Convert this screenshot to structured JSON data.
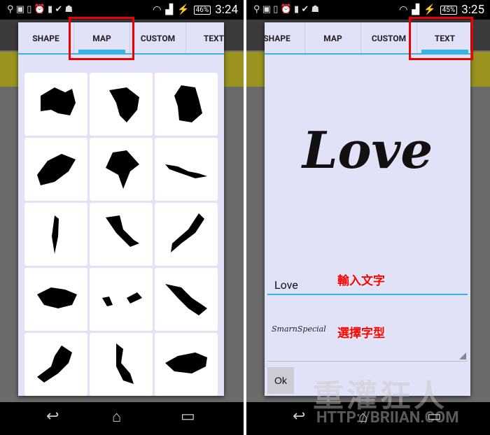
{
  "left": {
    "status": {
      "battery": "46%",
      "time": "3:24"
    },
    "tabs": [
      "SHAPE",
      "MAP",
      "CUSTOM",
      "TEXT"
    ],
    "selected_tab": "MAP",
    "map_tiles": [
      "australia-map-icon",
      "brazil-map-icon",
      "germany-map-icon",
      "switzerland-map-icon",
      "india-map-icon",
      "indonesia-map-icon",
      "israel-map-icon",
      "italy-map-icon",
      "japan-map-icon",
      "kazakhstan-map-icon",
      "malaysia-map-icon",
      "mexico-map-icon",
      "pakistan-map-icon",
      "philippines-map-icon",
      "russia-map-icon"
    ]
  },
  "right": {
    "status": {
      "battery": "45%",
      "time": "3:25"
    },
    "tabs": [
      "SHAPE",
      "MAP",
      "CUSTOM",
      "TEXT"
    ],
    "selected_tab": "TEXT",
    "preview_text": "Love",
    "input_value": "Love",
    "font_name": "SmarnSpecial",
    "ok_label": "Ok",
    "annotations": {
      "input": "輸入文字",
      "font": "選擇字型"
    }
  },
  "watermark": {
    "text": "重灌狂人",
    "url": "HTTP://BRIIAN.COM"
  },
  "colors": {
    "accent": "#33b5e5",
    "highlight": "#ee0000",
    "dialog": "#e1e1f8"
  }
}
